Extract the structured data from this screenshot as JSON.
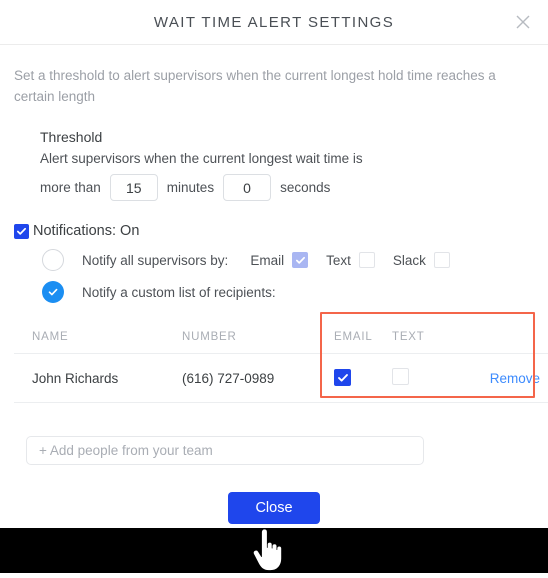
{
  "header": {
    "title": "WAIT TIME ALERT SETTINGS",
    "close_icon": "close-icon"
  },
  "description": "Set a threshold to alert supervisors when the current longest hold time reaches a certain length",
  "threshold": {
    "title": "Threshold",
    "subtitle": "Alert supervisors when the current longest wait time is",
    "prefix_label": "more than",
    "minutes_value": "15",
    "minutes_label": "minutes",
    "seconds_value": "0",
    "seconds_label": "seconds"
  },
  "notifications": {
    "toggle_label": "Notifications: On",
    "toggle_checked": true,
    "options": [
      {
        "label": "Notify all supervisors by:",
        "selected": false,
        "channels": [
          {
            "label": "Email",
            "checked": true
          },
          {
            "label": "Text",
            "checked": false
          },
          {
            "label": "Slack",
            "checked": false
          }
        ]
      },
      {
        "label": "Notify a custom list of recipients:",
        "selected": true
      }
    ]
  },
  "recipients_table": {
    "columns": [
      "NAME",
      "NUMBER",
      "EMAIL",
      "TEXT",
      ""
    ],
    "rows": [
      {
        "name": "John Richards",
        "number": "(616) 727-0989",
        "email_checked": true,
        "text_checked": false,
        "action_label": "Remove"
      }
    ]
  },
  "add_people": {
    "placeholder": "+ Add people from your team",
    "value": ""
  },
  "footer": {
    "close_label": "Close"
  },
  "colors": {
    "primary_blue": "#1f46ec",
    "radio_blue": "#1b8ef2",
    "link_blue": "#3d8bfd",
    "light_check": "#a9b6f2",
    "highlight_red": "#f4654a"
  }
}
